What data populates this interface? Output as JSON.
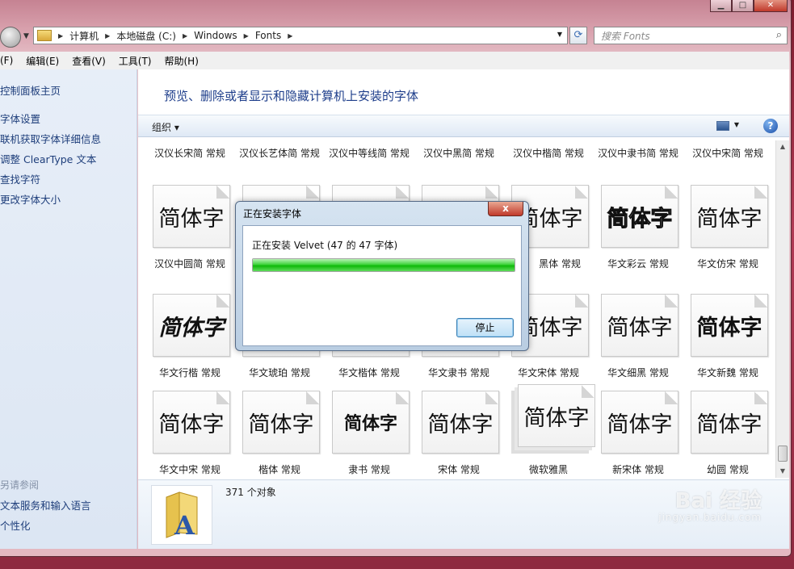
{
  "window": {
    "caption_buttons": [
      "minimize",
      "maximize",
      "close"
    ]
  },
  "address": {
    "crumbs": [
      "计算机",
      "本地磁盘 (C:)",
      "Windows",
      "Fonts"
    ]
  },
  "search": {
    "placeholder": "搜索 Fonts"
  },
  "menu": [
    "(F)",
    "编辑(E)",
    "查看(V)",
    "工具(T)",
    "帮助(H)"
  ],
  "sidebar": {
    "links": [
      "控制面板主页",
      "字体设置",
      "联机获取字体详细信息",
      "调整 ClearType 文本",
      "查找字符",
      "更改字体大小"
    ],
    "see_also_heading": "另请参阅",
    "see_also": [
      "文本服务和输入语言",
      "个性化"
    ]
  },
  "main": {
    "headline": "预览、删除或者显示和隐藏计算机上安装的字体",
    "organize_label": "组织",
    "top_labels": [
      "汉仪长宋简 常规",
      "汉仪长艺体简 常规",
      "汉仪中等线简 常规",
      "汉仪中黑简 常规",
      "汉仪中楷简 常规",
      "汉仪中隶书简 常规",
      "汉仪中宋简 常规"
    ],
    "rows": [
      {
        "tiles": [
          "简体字",
          "",
          "",
          "",
          "简体字",
          "简体字",
          "简体字"
        ],
        "labels": [
          "汉仪中圆简 常规",
          "",
          "",
          "",
          "黑体 常规",
          "华文彩云 常规",
          "华文仿宋 常规"
        ]
      },
      {
        "tiles": [
          "简体字",
          "",
          "",
          "",
          "简体字",
          "简体字",
          "简体字"
        ],
        "labels": [
          "华文行楷 常规",
          "华文琥珀 常规",
          "华文楷体 常规",
          "华文隶书 常规",
          "华文宋体 常规",
          "华文细黑 常规",
          "华文新魏 常规"
        ]
      },
      {
        "tiles": [
          "简体字",
          "简体字",
          "简体字",
          "简体字",
          "简体字",
          "简体字",
          "简体字"
        ],
        "labels": [
          "华文中宋 常规",
          "楷体 常规",
          "隶书 常规",
          "宋体 常规",
          "微软雅黑",
          "新宋体 常规",
          "幼圆 常规"
        ]
      }
    ],
    "status_count": "371 个对象"
  },
  "dialog": {
    "title": "正在安装字体",
    "message": "正在安装 Velvet (47 的 47 字体)",
    "progress": 1.0,
    "stop_label": "停止",
    "close_glyph": "x"
  },
  "watermark": {
    "brand": "Bai 经验",
    "sub": "jingyan.baidu.com"
  },
  "colors": {
    "link": "#1e3e7b",
    "headline": "#1e3e8b",
    "progress": "#0fb80a"
  }
}
